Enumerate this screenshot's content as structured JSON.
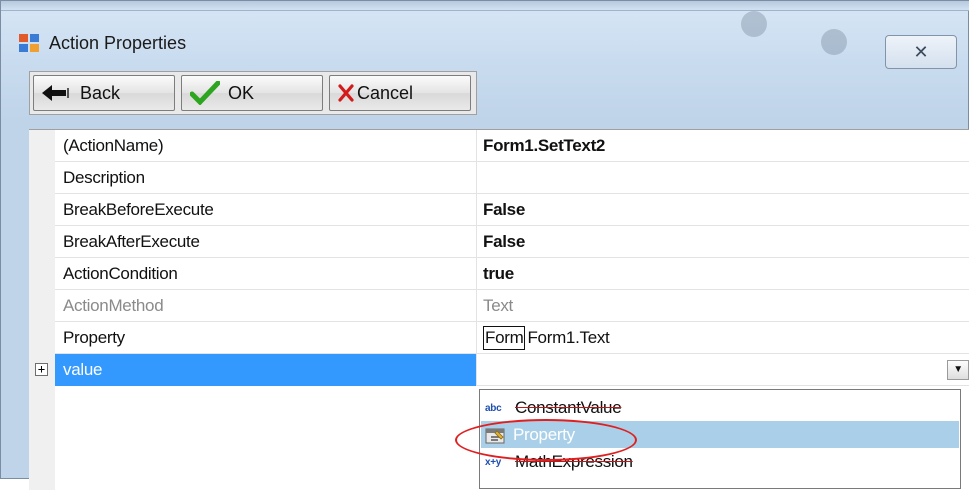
{
  "window": {
    "title": "Action Properties",
    "close_glyph": "✕"
  },
  "toolbar": {
    "back_label": "Back",
    "ok_label": "OK",
    "cancel_label": "Cancel"
  },
  "properties": [
    {
      "name": "(ActionName)",
      "value": "Form1.SetText2",
      "bold": true
    },
    {
      "name": "Description",
      "value": ""
    },
    {
      "name": "BreakBeforeExecute",
      "value": "False",
      "bold": true
    },
    {
      "name": "BreakAfterExecute",
      "value": "False",
      "bold": true
    },
    {
      "name": "ActionCondition",
      "value": "true",
      "bold": true
    },
    {
      "name": "ActionMethod",
      "value": "Text",
      "muted": true
    },
    {
      "name": "Property",
      "value_box": "Form",
      "value": "Form1.Text"
    },
    {
      "name": "value",
      "value": "",
      "selected": true
    }
  ],
  "dropdown": {
    "items": [
      {
        "tag": "abc",
        "label": "ConstantValue"
      },
      {
        "tag": "",
        "label": "Property",
        "highlighted": true
      },
      {
        "tag": "x+y",
        "label": "MathExpression"
      }
    ]
  },
  "colors": {
    "selection": "#3399ff",
    "highlight": "#a9d0e8",
    "annotation": "#e02020"
  }
}
